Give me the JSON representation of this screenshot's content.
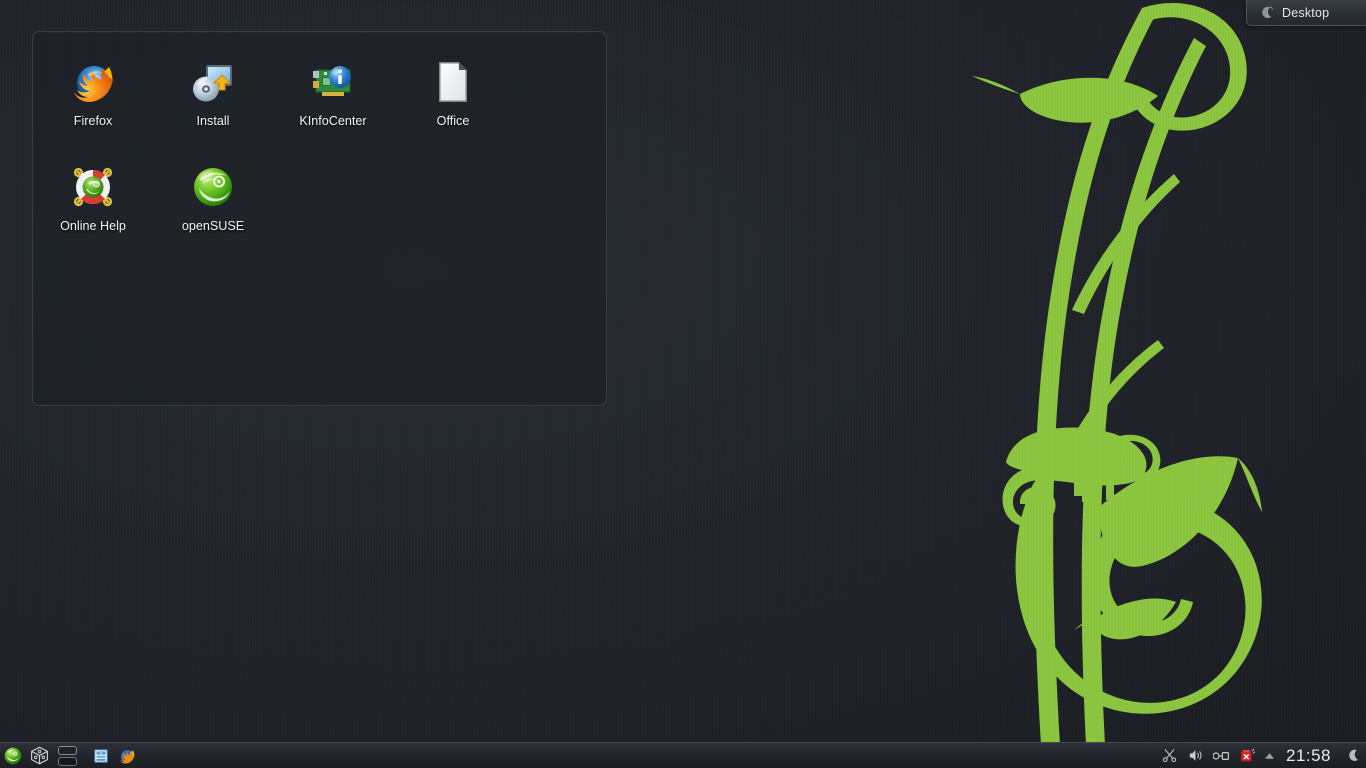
{
  "desktop": {
    "background_color": "#1e2228",
    "accent_green": "#8cc63e",
    "toolbox": {
      "label": "Desktop",
      "icon": "cashew-icon"
    }
  },
  "folder_view": {
    "icons": [
      {
        "label": "Firefox",
        "icon": "firefox-icon"
      },
      {
        "label": "Install",
        "icon": "install-cd-icon"
      },
      {
        "label": "KInfoCenter",
        "icon": "kinfocenter-card-icon"
      },
      {
        "label": "Office",
        "icon": "libreoffice-document-icon"
      },
      {
        "label": "Online Help",
        "icon": "lifebuoy-help-icon"
      },
      {
        "label": "openSUSE",
        "icon": "opensuse-geeko-icon"
      }
    ]
  },
  "panel": {
    "launchers": [
      {
        "name": "kickoff-application-launcher",
        "icon": "opensuse-menu-icon"
      },
      {
        "name": "show-desktop",
        "icon": "cube-desktop-icon"
      }
    ],
    "pager": {
      "desktops": [
        "1",
        "2"
      ],
      "active": 1
    },
    "task_launchers": [
      {
        "name": "file-manager",
        "icon": "dolphin-filemanager-icon"
      },
      {
        "name": "web-browser",
        "icon": "firefox-icon"
      }
    ],
    "tray": [
      {
        "name": "klipper",
        "icon": "scissors-icon"
      },
      {
        "name": "volume-control",
        "icon": "speaker-icon"
      },
      {
        "name": "device-notifier",
        "icon": "usb-device-icon"
      },
      {
        "name": "network-status",
        "icon": "network-disconnected-icon"
      }
    ],
    "tray_expand": {
      "icon": "chevron-up-icon"
    },
    "clock": {
      "time": "21:58"
    },
    "moon": {
      "icon": "moon-phase-icon"
    }
  }
}
